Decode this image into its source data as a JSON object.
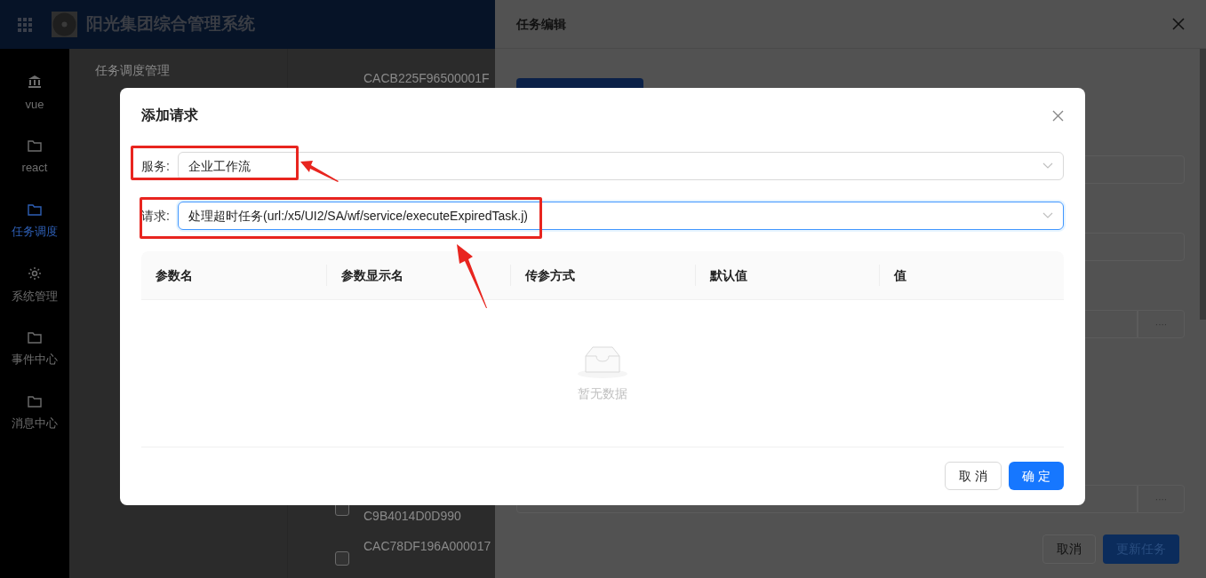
{
  "app": {
    "title": "阳光集团综合管理系统"
  },
  "sidebar": {
    "items": [
      {
        "label": "vue",
        "selected": false
      },
      {
        "label": "react",
        "selected": false
      },
      {
        "label": "任务调度",
        "selected": true
      },
      {
        "label": "系统管理",
        "selected": false
      },
      {
        "label": "事件中心",
        "selected": false
      },
      {
        "label": "消息中心",
        "selected": false
      }
    ]
  },
  "page": {
    "breadcrumb": "任务调度管理",
    "rows": [
      {
        "id": "CACB225F96500001F"
      },
      {
        "id": "C9B4014D0D990",
        "checked": false
      },
      {
        "id": "CAC78DF196A000017",
        "checked": false
      }
    ]
  },
  "drawer": {
    "title": "任务编辑",
    "fields": [
      {
        "kind": "plain"
      },
      {
        "kind": "plain"
      },
      {
        "kind": "picker",
        "button": "····"
      },
      {
        "kind": "picker",
        "button": "····"
      }
    ],
    "buttons": [
      {
        "label": "取消",
        "kind": "default"
      },
      {
        "label": "更新任务",
        "kind": "primary"
      }
    ]
  },
  "dialog": {
    "title": "添加请求",
    "fields": [
      {
        "label": "服务:",
        "value": "企业工作流",
        "focused": false
      },
      {
        "label": "请求:",
        "value": "处理超时任务(url:/x5/UI2/SA/wf/service/executeExpiredTask.j)",
        "focused": true
      }
    ],
    "table": {
      "columns": [
        "参数名",
        "参数显示名",
        "传参方式",
        "默认值",
        "值"
      ],
      "empty_text": "暂无数据"
    },
    "buttons": [
      {
        "label": "取 消",
        "kind": "default"
      },
      {
        "label": "确 定",
        "kind": "primary"
      }
    ]
  }
}
